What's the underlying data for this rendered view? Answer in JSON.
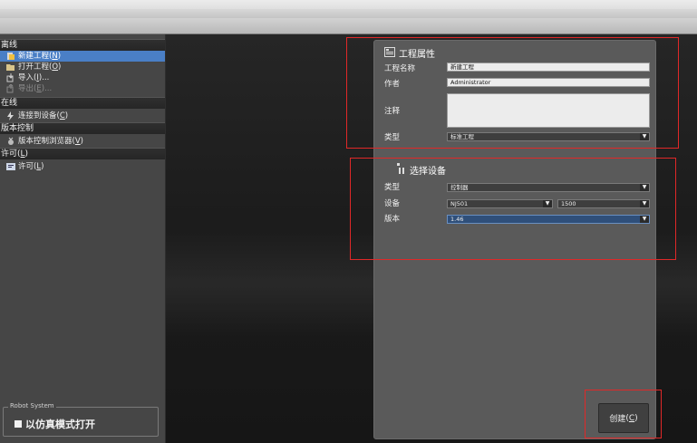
{
  "sidebar": {
    "offline": {
      "header": "离线",
      "items": [
        {
          "label": "新建工程",
          "accel": "N"
        },
        {
          "label": "打开工程",
          "accel": "O"
        },
        {
          "label": "导入",
          "accel": "I",
          "suffix": "..."
        },
        {
          "label": "导出",
          "accel": "E",
          "suffix": "..."
        }
      ]
    },
    "online": {
      "header": "在线",
      "items": [
        {
          "label": "连接到设备",
          "accel": "C"
        }
      ]
    },
    "version": {
      "header": "版本控制",
      "items": [
        {
          "label": "版本控制浏览器",
          "accel": "V"
        }
      ]
    },
    "license": {
      "header_label": "许可",
      "header_accel": "L",
      "items": [
        {
          "label": "许可",
          "accel": "L"
        }
      ]
    },
    "robot": {
      "legend": "Robot System",
      "option": "以仿真模式打开"
    }
  },
  "project_props": {
    "title": "工程属性",
    "name_label": "工程名称",
    "name_value": "新建工程",
    "author_label": "作者",
    "author_value": "Administrator",
    "comment_label": "注释",
    "comment_value": "",
    "type_label": "类型",
    "type_value": "标准工程"
  },
  "device_select": {
    "title": "选择设备",
    "type_label": "类型",
    "type_value": "控制器",
    "device_label": "设备",
    "device_value": "NJ501",
    "device_model": "1500",
    "version_label": "版本",
    "version_value": "1.46"
  },
  "create_button": {
    "label": "创建",
    "accel": "C"
  },
  "colors": {
    "highlight": "#e02828",
    "selected": "#4a7fc6"
  }
}
